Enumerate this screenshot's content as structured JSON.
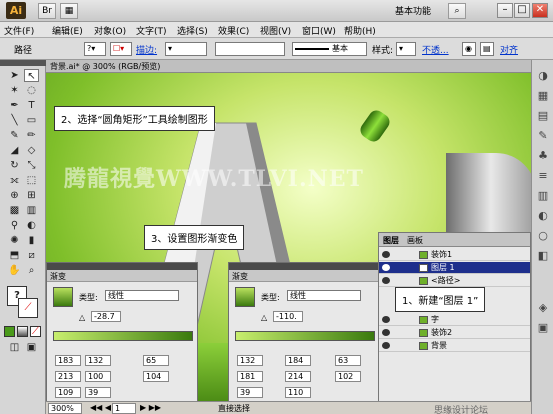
{
  "titlebar": {
    "logo": "Ai",
    "workspace": "基本功能",
    "win_min": "–",
    "win_max": "□",
    "win_close": "✕"
  },
  "menu": [
    "文件(F)",
    "编辑(E)",
    "对象(O)",
    "文字(T)",
    "选择(S)",
    "效果(C)",
    "视图(V)",
    "窗口(W)",
    "帮助(H)"
  ],
  "controlbar": {
    "selection": "路径",
    "stroke_label": "描边:",
    "stroke_style": "基本",
    "style_label": "样式:",
    "opacity_link": "不透...",
    "align_link": "对齐"
  },
  "document": {
    "tab_label": "背景.ai* @ 300% (RGB/预览)"
  },
  "canvas": {
    "watermark": "腾龍視覺WWW.TLVI.NET",
    "callout_1": "2、选择“圆角矩形”工具绘制图形",
    "callout_2": "3、设置图形渐变色",
    "callout_3": "1、新建“图层 1”"
  },
  "layers_panel": {
    "tabs": [
      "图层",
      "画板"
    ],
    "rows": [
      {
        "name": "装饰1",
        "selected": false
      },
      {
        "name": "图层 1",
        "selected": true
      },
      {
        "name": "<路径>",
        "selected": false
      },
      {
        "name": "字",
        "selected": false
      },
      {
        "name": "装饰2",
        "selected": false
      },
      {
        "name": "背景",
        "selected": false
      }
    ]
  },
  "gradient_panels": [
    {
      "tab": "渐变",
      "type_label": "类型:",
      "type_value": "线性",
      "angle": "-28.7",
      "stop_values": [
        "183",
        "132",
        "65",
        "213",
        "100",
        "104",
        "109",
        "39"
      ]
    },
    {
      "tab": "渐变",
      "type_label": "类型:",
      "type_value": "线性",
      "angle": "-110.",
      "stop_values": [
        "132",
        "184",
        "63",
        "181",
        "214",
        "102",
        "39",
        "110"
      ]
    }
  ],
  "statusbar": {
    "zoom": "300%",
    "page": "1",
    "tool": "直接选择",
    "corner_brand": "思缘设计论坛"
  },
  "colors": {
    "canvas_green": "#7fbf2a",
    "selected_layer": "#1e2f8c",
    "link_blue": "#0033cc"
  }
}
